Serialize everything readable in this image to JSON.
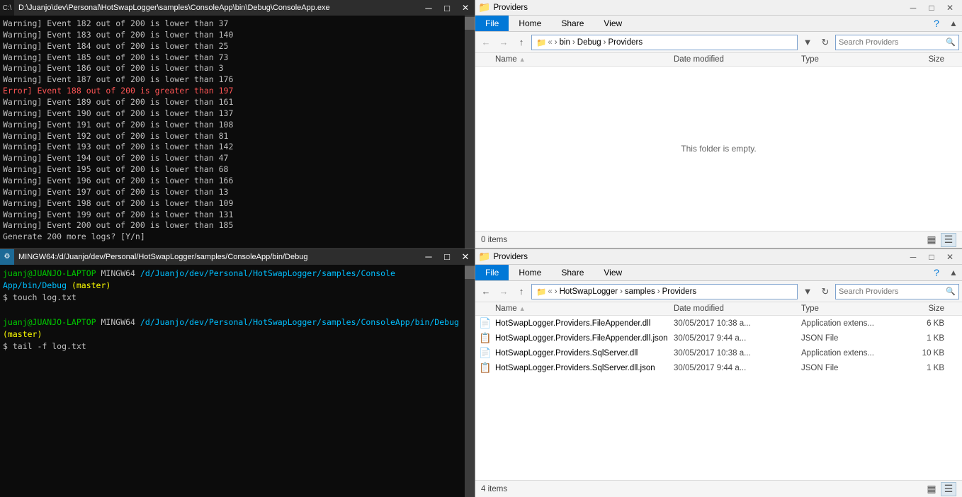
{
  "terminal1": {
    "title": "D:\\Juanjo\\dev\\Personal\\HotSwapLogger\\samples\\ConsoleApp\\bin\\Debug\\ConsoleApp.exe",
    "lines": [
      {
        "type": "normal",
        "text": "Warning] Event 182 out of 200 is lower than 37"
      },
      {
        "type": "normal",
        "text": "Warning] Event 183 out of 200 is lower than 140"
      },
      {
        "type": "normal",
        "text": "Warning] Event 184 out of 200 is lower than 25"
      },
      {
        "type": "normal",
        "text": "Warning] Event 185 out of 200 is lower than 73"
      },
      {
        "type": "normal",
        "text": "Warning] Event 186 out of 200 is lower than 3"
      },
      {
        "type": "normal",
        "text": "Warning] Event 187 out of 200 is lower than 176"
      },
      {
        "type": "error",
        "text": "Error] Event 188 out of 200 is greater than 197"
      },
      {
        "type": "normal",
        "text": "Warning] Event 189 out of 200 is lower than 161"
      },
      {
        "type": "normal",
        "text": "Warning] Event 190 out of 200 is lower than 137"
      },
      {
        "type": "normal",
        "text": "Warning] Event 191 out of 200 is lower than 108"
      },
      {
        "type": "normal",
        "text": "Warning] Event 192 out of 200 is lower than 81"
      },
      {
        "type": "normal",
        "text": "Warning] Event 193 out of 200 is lower than 142"
      },
      {
        "type": "normal",
        "text": "Warning] Event 194 out of 200 is lower than 47"
      },
      {
        "type": "normal",
        "text": "Warning] Event 195 out of 200 is lower than 68"
      },
      {
        "type": "normal",
        "text": "Warning] Event 196 out of 200 is lower than 166"
      },
      {
        "type": "normal",
        "text": "Warning] Event 197 out of 200 is lower than 13"
      },
      {
        "type": "normal",
        "text": "Warning] Event 198 out of 200 is lower than 109"
      },
      {
        "type": "normal",
        "text": "Warning] Event 199 out of 200 is lower than 131"
      },
      {
        "type": "normal",
        "text": "Warning] Event 200 out of 200 is lower than 185"
      },
      {
        "type": "prompt_line",
        "text": "Generate 200 more logs? [Y/n]"
      }
    ]
  },
  "terminal2": {
    "title": "MINGW64:/d/Juanjo/dev/Personal/HotSwapLogger/samples/ConsoleApp/bin/Debug",
    "lines": [
      {
        "type": "prompt",
        "user": "juanj@JUANJO-LAPTOP",
        "shell": "MINGW64",
        "path": "/d/Juanjo/dev/Personal/HotSwapLogger/samples/Console",
        "cont": "App/bin/Debug (master)"
      },
      {
        "type": "cmd",
        "text": "$ touch log.txt"
      },
      {
        "type": "blank"
      },
      {
        "type": "prompt",
        "user": "juanj@JUANJO-LAPTOP",
        "shell": "MINGW64",
        "path": "/d/Juanjo/dev/Personal/HotSwapLogger/samples/ConsoleApp/bin/Debug",
        "cont": null
      },
      {
        "type": "cmd2",
        "text": "(master)"
      },
      {
        "type": "cmd",
        "text": "$ tail -f log.txt"
      }
    ]
  },
  "explorer1": {
    "title": "Providers",
    "tabs": [
      "File",
      "Home",
      "Share",
      "View"
    ],
    "active_tab": "File",
    "path_segments": [
      "bin",
      "Debug",
      "Providers"
    ],
    "search_placeholder": "Search Providers",
    "columns": {
      "name": "Name",
      "date": "Date modified",
      "type": "Type",
      "size": "Size"
    },
    "empty_message": "This folder is empty.",
    "status": "0 items"
  },
  "explorer2": {
    "title": "Providers",
    "tabs": [
      "File",
      "Home",
      "Share",
      "View"
    ],
    "active_tab": "File",
    "path_segments": [
      "HotSwapLogger",
      "samples",
      "Providers"
    ],
    "search_placeholder": "Search Providers",
    "columns": {
      "name": "Name",
      "date": "Date modified",
      "type": "Type",
      "size": "Size"
    },
    "files": [
      {
        "name": "HotSwapLogger.Providers.FileAppender.dll",
        "date": "30/05/2017 10:38 a...",
        "type": "Application extens...",
        "size": "6 KB"
      },
      {
        "name": "HotSwapLogger.Providers.FileAppender.dll.json",
        "date": "30/05/2017 9:44 a...",
        "type": "JSON File",
        "size": "1 KB"
      },
      {
        "name": "HotSwapLogger.Providers.SqlServer.dll",
        "date": "30/05/2017 10:38 a...",
        "type": "Application extens...",
        "size": "10 KB"
      },
      {
        "name": "HotSwapLogger.Providers.SqlServer.dll.json",
        "date": "30/05/2017 9:44 a...",
        "type": "JSON File",
        "size": "1 KB"
      }
    ]
  },
  "icons": {
    "folder": "📁",
    "dll": "📄",
    "json": "📋",
    "search": "🔍",
    "back": "←",
    "forward": "→",
    "up": "↑",
    "refresh": "↻",
    "minimize": "─",
    "maximize": "□",
    "close": "✕",
    "chevron": "›",
    "sort_up": "▲",
    "grid_view": "▦",
    "detail_view": "☰"
  }
}
